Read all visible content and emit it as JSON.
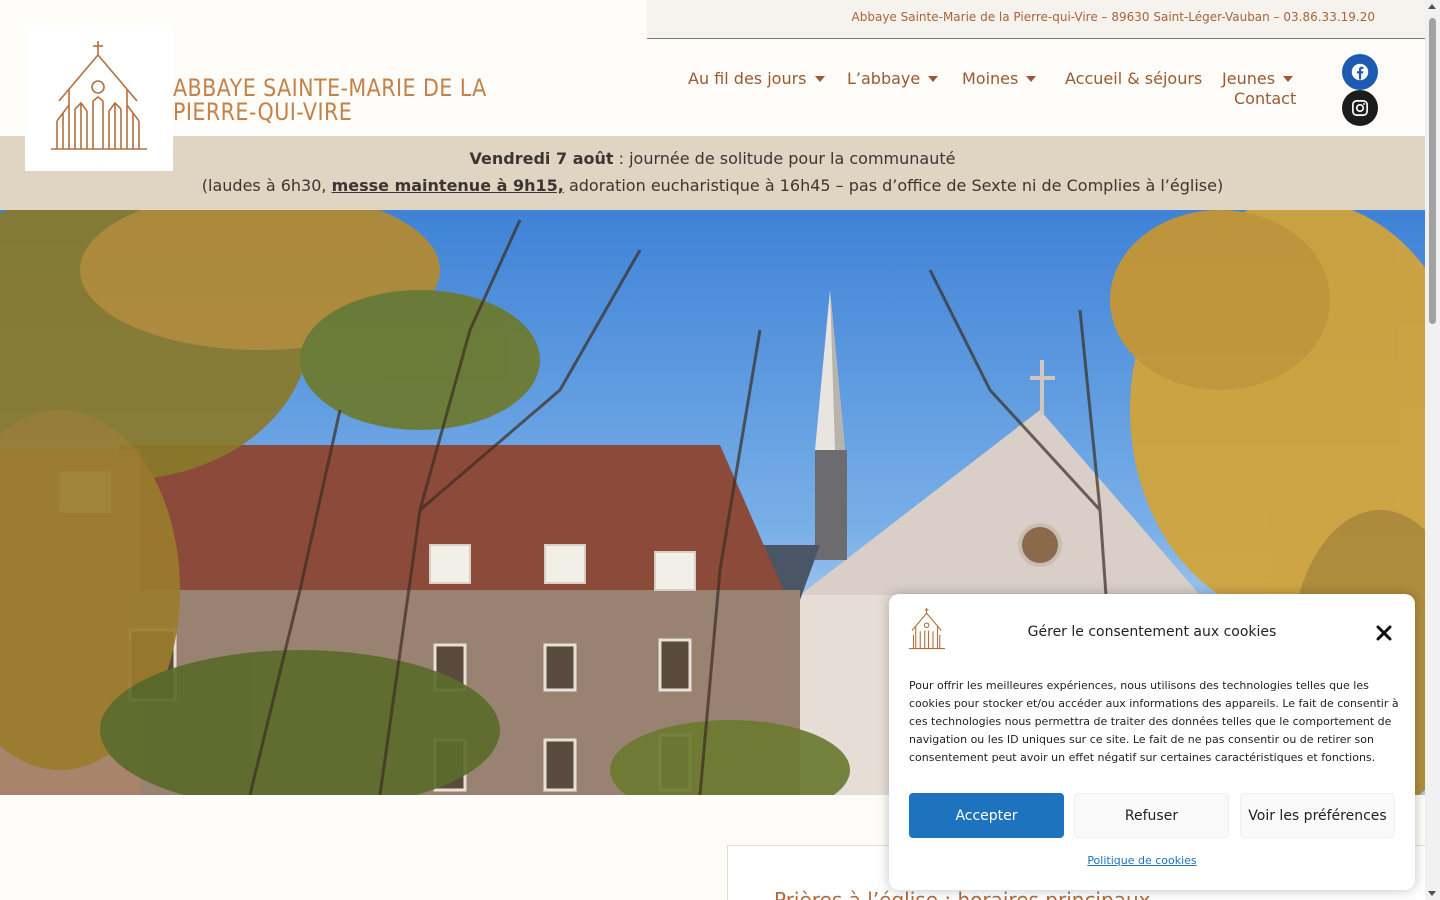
{
  "topbar": {
    "address": "Abbaye Sainte-Marie de la Pierre-qui-Vire – 89630 Saint-Léger-Vauban – 03.86.33.19.20"
  },
  "header": {
    "site_title": "ABBAYE SAINTE-MARIE DE LA PIERRE-QUI-VIRE"
  },
  "nav": {
    "items": [
      {
        "label": "Au fil des jours",
        "dropdown": true
      },
      {
        "label": "L’abbaye",
        "dropdown": true
      },
      {
        "label": "Moines",
        "dropdown": true
      },
      {
        "label": "Accueil & séjours",
        "dropdown": false
      },
      {
        "label": "Jeunes",
        "dropdown": true
      },
      {
        "label": "Contact",
        "dropdown": false
      }
    ],
    "social": [
      {
        "icon": "facebook-icon",
        "color": "#1d5bb2"
      },
      {
        "icon": "instagram-icon",
        "color": "#1c1c1c"
      }
    ]
  },
  "announcement": {
    "date": "Vendredi 7 août",
    "line1_rest": " : journée de solitude pour la communauté",
    "line2_start": "(laudes à 6h30, ",
    "line2_link": "messe maintenue à 9h15,",
    "line2_end": " adoration eucharistique à 16h45 – pas d’office de Sexte ni de Complies à l’église)"
  },
  "content": {
    "section_title": "Prières à l’église : horaires principaux"
  },
  "cookie": {
    "title": "Gérer le consentement aux cookies",
    "body": "Pour offrir les meilleures expériences, nous utilisons des technologies telles que les cookies pour stocker et/ou accéder aux informations des appareils. Le fait de consentir à ces technologies nous permettra de traiter des données telles que le comportement de navigation ou les ID uniques sur ce site. Le fait de ne pas consentir ou de retirer son consentement peut avoir un effet négatif sur certaines caractéristiques et fonctions.",
    "accept": "Accepter",
    "refuse": "Refuser",
    "preferences": "Voir les préférences",
    "policy_link": "Politique de cookies"
  },
  "colors": {
    "accent": "#9b5a32",
    "announce_bg": "#e0d4c2",
    "primary_button": "#1e73be"
  }
}
